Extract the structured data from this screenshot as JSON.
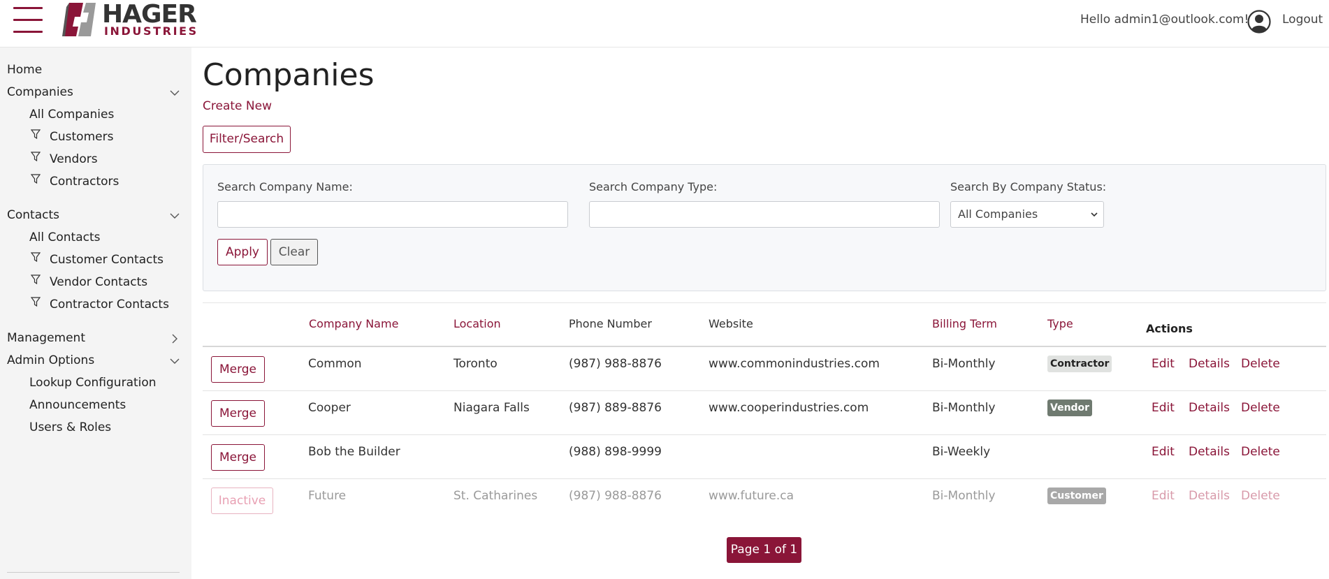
{
  "header": {
    "logo_main": "HAGER",
    "logo_sub": "INDUSTRIES",
    "greeting": "Hello admin1@outlook.com!",
    "logout": "Logout"
  },
  "sidebar": {
    "home": "Home",
    "companies": "Companies",
    "companies_items": [
      "All Companies",
      "Customers",
      "Vendors",
      "Contractors"
    ],
    "contacts": "Contacts",
    "contacts_items": [
      "All Contacts",
      "Customer Contacts",
      "Vendor Contacts",
      "Contractor Contacts"
    ],
    "management": "Management",
    "admin": "Admin Options",
    "admin_items": [
      "Lookup Configuration",
      "Announcements",
      "Users & Roles"
    ]
  },
  "main": {
    "title": "Companies",
    "create_new": "Create New",
    "filter_button": "Filter/Search"
  },
  "filter": {
    "name_label": "Search Company Name:",
    "name_value": "",
    "type_label": "Search Company Type:",
    "type_value": "",
    "status_label": "Search By Company Status:",
    "status_selected": "All Companies",
    "apply": "Apply",
    "clear": "Clear"
  },
  "table": {
    "headers": {
      "name": "Company Name",
      "location": "Location",
      "phone": "Phone Number",
      "website": "Website",
      "billing": "Billing Term",
      "type": "Type",
      "actions": "Actions"
    },
    "rows": [
      {
        "button": "Merge",
        "name": "Common",
        "location": "Toronto",
        "phone": "(987) 988-8876",
        "website": "www.commonindustries.com",
        "billing": "Bi-Monthly",
        "type": "Contractor",
        "edit": "Edit",
        "details": "Details",
        "delete": "Delete"
      },
      {
        "button": "Merge",
        "name": "Cooper",
        "location": "Niagara Falls",
        "phone": "(987) 889-8876",
        "website": "www.cooperindustries.com",
        "billing": "Bi-Monthly",
        "type": "Vendor",
        "edit": "Edit",
        "details": "Details",
        "delete": "Delete"
      },
      {
        "button": "Merge",
        "name": "Bob the Builder",
        "location": "",
        "phone": "(988) 898-9999",
        "website": "",
        "billing": "Bi-Weekly",
        "type": "",
        "edit": "Edit",
        "details": "Details",
        "delete": "Delete"
      },
      {
        "button": "Inactive",
        "name": "Future",
        "location": "St. Catharines",
        "phone": "(987) 988-8876",
        "website": "www.future.ca",
        "billing": "Bi-Monthly",
        "type": "Customer",
        "edit": "Edit",
        "details": "Details",
        "delete": "Delete"
      }
    ]
  },
  "pager": {
    "label": "Page 1 of 1"
  },
  "colors": {
    "brand": "#8a1538",
    "badge_contractor": "#e0e2e0",
    "badge_vendor": "#6f7a70",
    "badge_customer": "#a8a8a8"
  }
}
